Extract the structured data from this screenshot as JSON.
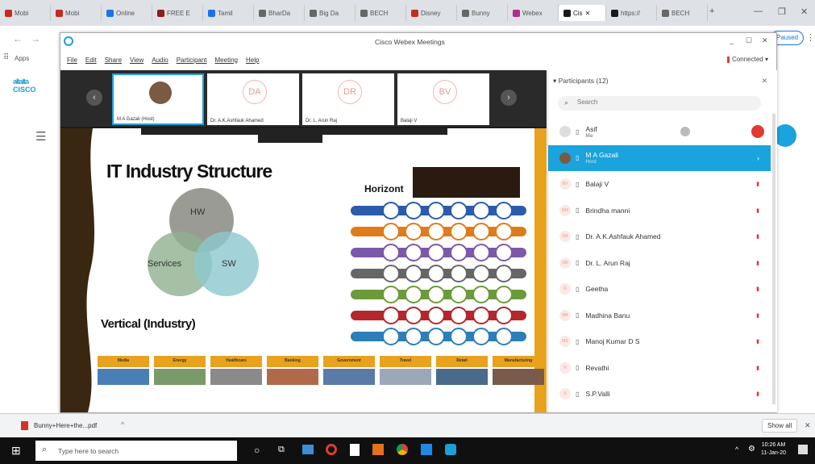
{
  "browser": {
    "tabs": [
      {
        "label": "Mobi",
        "color": "#c72b1f"
      },
      {
        "label": "Mobi",
        "color": "#c72b1f"
      },
      {
        "label": "Online",
        "color": "#1a73e8"
      },
      {
        "label": "FREE E",
        "color": "#8b1d1d"
      },
      {
        "label": "Tamil ",
        "color": "#1a73e8"
      },
      {
        "label": "BharDa",
        "color": "#666666"
      },
      {
        "label": "Big Da",
        "color": "#666666"
      },
      {
        "label": "BECH",
        "color": "#666666"
      },
      {
        "label": "Disney",
        "color": "#c72b1f"
      },
      {
        "label": "Bunny",
        "color": "#666666"
      },
      {
        "label": "Webex",
        "color": "#b32d8f"
      },
      {
        "label": "Cis",
        "color": "#1a1a1a"
      },
      {
        "label": "https://",
        "color": "#1a1a1a"
      },
      {
        "label": "BECH",
        "color": "#666666"
      }
    ],
    "new_tab": "+",
    "apps_label": "Apps",
    "paused_label": "Paused"
  },
  "page": {
    "logo_line1": "altalta",
    "logo_line2": "CISCO"
  },
  "webex": {
    "title": "Cisco Webex Meetings",
    "connected": "Connected",
    "menu": [
      "File",
      "Edit",
      "Share",
      "View",
      "Audio",
      "Participant",
      "Meeting",
      "Help"
    ],
    "thumbnails": [
      {
        "initials": "",
        "name": "M A Gazali (Host)"
      },
      {
        "initials": "DA",
        "name": "Dr. A.K.Ashfauk Ahamed"
      },
      {
        "initials": "DR",
        "name": "Dr. L. Arun Raj"
      },
      {
        "initials": "BV",
        "name": "Balaji V"
      }
    ],
    "slide": {
      "title": "IT Industry Structure",
      "venn": [
        "HW",
        "Services",
        "SW"
      ],
      "horizontal_heading": "Horizont",
      "vertical_heading": "Vertical (Industry)",
      "industries": [
        "Media",
        "Energy",
        "Healthcare",
        "Banking",
        "Government",
        "Travel",
        "Retail",
        "Manufacturing"
      ],
      "bands": [
        {
          "color": "#2b5caa"
        },
        {
          "color": "#e07b1a"
        },
        {
          "color": "#7c59a8"
        },
        {
          "color": "#666666"
        },
        {
          "color": "#6b9a3a"
        },
        {
          "color": "#b3272d"
        },
        {
          "color": "#2c7fb8"
        }
      ]
    },
    "participants": {
      "header": "Participants (12)",
      "search_placeholder": "Search",
      "list": [
        {
          "name": "Asif",
          "sub": "Me",
          "initials": "",
          "selected": false
        },
        {
          "name": "M A Gazali",
          "sub": "Host",
          "initials": "",
          "selected": true
        },
        {
          "name": "Balaji V",
          "initials": "BV",
          "selected": false
        },
        {
          "name": "Brindha manni",
          "initials": "BM",
          "selected": false
        },
        {
          "name": "Dr. A.K.Ashfauk Ahamed",
          "initials": "DA",
          "selected": false
        },
        {
          "name": "Dr. L. Arun Raj",
          "initials": "DR",
          "selected": false
        },
        {
          "name": "Geetha",
          "initials": "G",
          "selected": false
        },
        {
          "name": "Madhina Banu",
          "initials": "MB",
          "selected": false
        },
        {
          "name": "Manoj Kumar D S",
          "initials": "MS",
          "selected": false
        },
        {
          "name": "Revathi",
          "initials": "R",
          "selected": false
        },
        {
          "name": "S.P.Valli",
          "initials": "S",
          "selected": false
        }
      ]
    }
  },
  "downloads": {
    "file": "Bunny+Here+the...pdf",
    "show_all": "Show all"
  },
  "taskbar": {
    "search_placeholder": "Type here to search",
    "time": "10:26 AM",
    "date": "11-Jan-20"
  }
}
